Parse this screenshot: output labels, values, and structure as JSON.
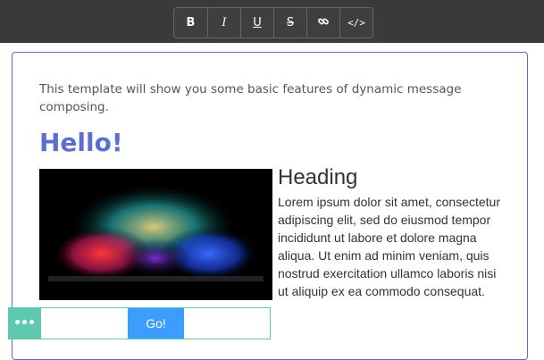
{
  "toolbar": {
    "bold_label": "B",
    "italic_label": "I",
    "underline_label": "U",
    "strike_label": "S",
    "code_label": "</>"
  },
  "content": {
    "intro": "This template will show you some basic features of dynamic message composing.",
    "hello": "Hello!",
    "heading": "Heading",
    "paragraph": "Lorem ipsum dolor sit amet, consectetur adipiscing elit, sed do eiusmod tempor incididunt ut labore et dolore magna aliqua. Ut enim ad minim veniam, quis nostrud exercitation ullamco laboris nisi ut aliquip ex ea commodo consequat."
  },
  "button_block": {
    "handle_label": "•••",
    "go_label": "Go!"
  },
  "colors": {
    "accent": "#5b6fd0",
    "teal": "#5fc9b0",
    "button_blue": "#3b9eff",
    "toolbar_bg": "#3a3a3a"
  },
  "icons": [
    "link-icon",
    "image-icon",
    "more-icon"
  ]
}
